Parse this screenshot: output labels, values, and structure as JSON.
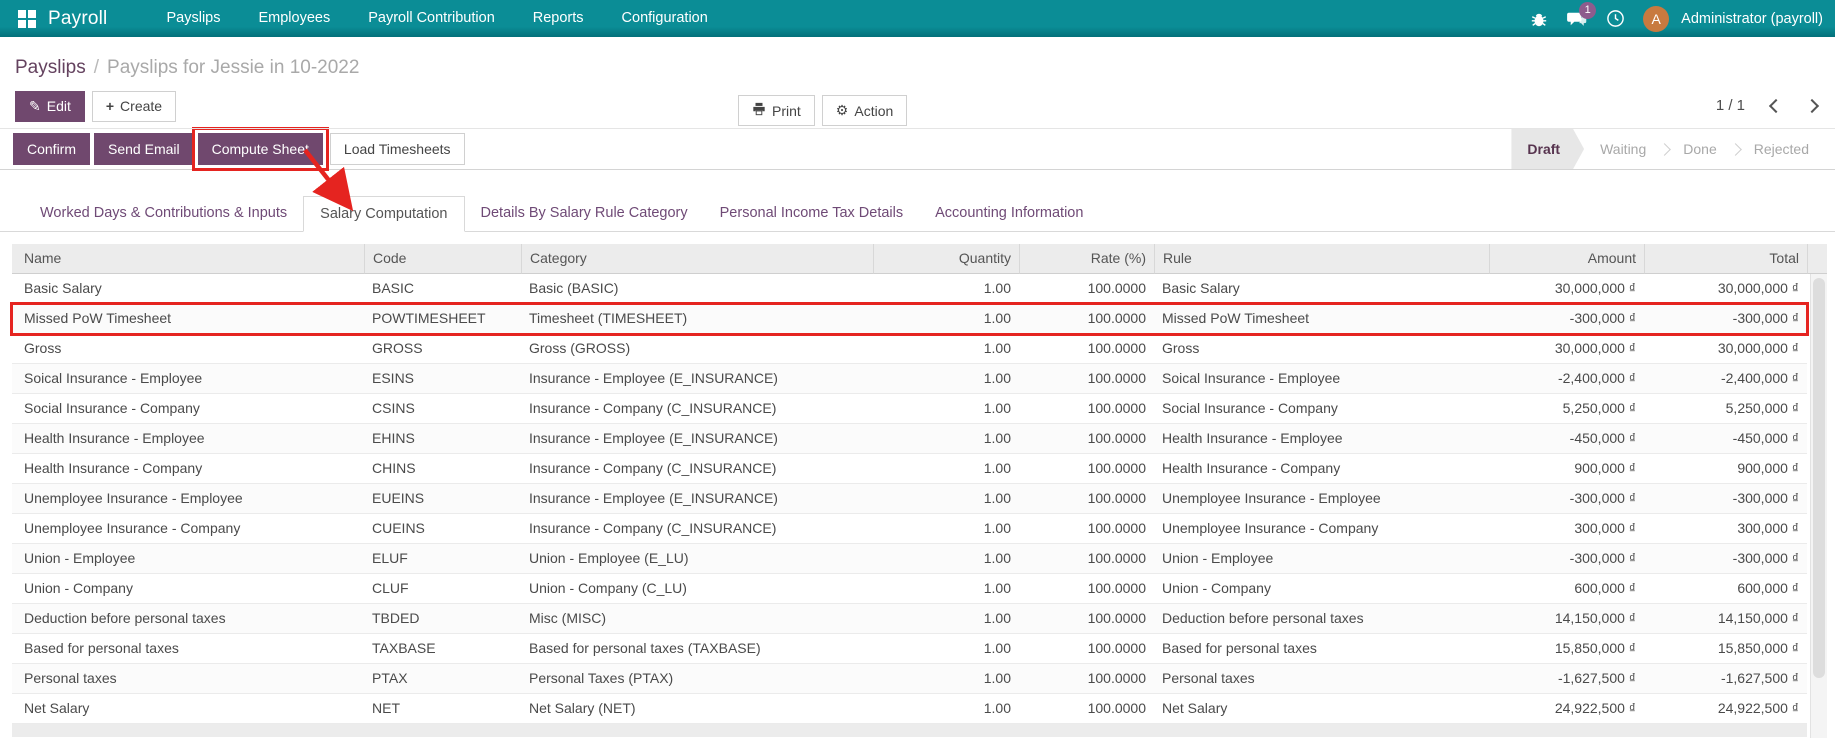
{
  "app": {
    "brand": "Payroll",
    "menus": [
      "Payslips",
      "Employees",
      "Payroll Contribution",
      "Reports",
      "Configuration"
    ],
    "user_name": "Administrator (payroll)",
    "avatar_letter": "A",
    "message_badge": "1"
  },
  "breadcrumb": {
    "parent": "Payslips",
    "separator": "/",
    "current": "Payslips for Jessie in 10-2022"
  },
  "actions": {
    "edit": "Edit",
    "create": "Create",
    "print": "Print",
    "action": "Action",
    "edit_icon_glyph": "✎",
    "create_icon_glyph": "+",
    "action_icon_glyph": "⚙"
  },
  "pager": {
    "value": "1 / 1"
  },
  "statusbar": {
    "buttons": [
      {
        "label": "Confirm",
        "style": "primary"
      },
      {
        "label": "Send Email",
        "style": "primary"
      },
      {
        "label": "Compute Sheet",
        "style": "primary"
      },
      {
        "label": "Load Timesheets",
        "style": "default"
      }
    ],
    "states": [
      "Draft",
      "Waiting",
      "Done",
      "Rejected"
    ],
    "active_state": "Draft"
  },
  "notebook": {
    "tabs": [
      "Worked Days & Contributions & Inputs",
      "Salary Computation",
      "Details By Salary Rule Category",
      "Personal Income Tax Details",
      "Accounting Information"
    ],
    "active_tab": "Salary Computation"
  },
  "table": {
    "columns": [
      {
        "key": "name",
        "label": "Name",
        "align": "left"
      },
      {
        "key": "code",
        "label": "Code",
        "align": "left"
      },
      {
        "key": "category",
        "label": "Category",
        "align": "left"
      },
      {
        "key": "quantity",
        "label": "Quantity",
        "align": "right"
      },
      {
        "key": "rate",
        "label": "Rate (%)",
        "align": "right"
      },
      {
        "key": "rule",
        "label": "Rule",
        "align": "left"
      },
      {
        "key": "amount",
        "label": "Amount",
        "align": "right"
      },
      {
        "key": "total",
        "label": "Total",
        "align": "right"
      }
    ],
    "rows": [
      {
        "name": "Basic Salary",
        "code": "BASIC",
        "category": "Basic (BASIC)",
        "quantity": "1.00",
        "rate": "100.0000",
        "rule": "Basic Salary",
        "amount": "30,000,000 ₫",
        "total": "30,000,000 ₫"
      },
      {
        "name": "Missed PoW Timesheet",
        "code": "POWTIMESHEET",
        "category": "Timesheet (TIMESHEET)",
        "quantity": "1.00",
        "rate": "100.0000",
        "rule": "Missed PoW Timesheet",
        "amount": "-300,000 ₫",
        "total": "-300,000 ₫"
      },
      {
        "name": "Gross",
        "code": "GROSS",
        "category": "Gross (GROSS)",
        "quantity": "1.00",
        "rate": "100.0000",
        "rule": "Gross",
        "amount": "30,000,000 ₫",
        "total": "30,000,000 ₫"
      },
      {
        "name": "Soical Insurance - Employee",
        "code": "ESINS",
        "category": "Insurance - Employee (E_INSURANCE)",
        "quantity": "1.00",
        "rate": "100.0000",
        "rule": "Soical Insurance - Employee",
        "amount": "-2,400,000 ₫",
        "total": "-2,400,000 ₫"
      },
      {
        "name": "Social Insurance - Company",
        "code": "CSINS",
        "category": "Insurance - Company (C_INSURANCE)",
        "quantity": "1.00",
        "rate": "100.0000",
        "rule": "Social Insurance - Company",
        "amount": "5,250,000 ₫",
        "total": "5,250,000 ₫"
      },
      {
        "name": "Health Insurance - Employee",
        "code": "EHINS",
        "category": "Insurance - Employee (E_INSURANCE)",
        "quantity": "1.00",
        "rate": "100.0000",
        "rule": "Health Insurance - Employee",
        "amount": "-450,000 ₫",
        "total": "-450,000 ₫"
      },
      {
        "name": "Health Insurance - Company",
        "code": "CHINS",
        "category": "Insurance - Company (C_INSURANCE)",
        "quantity": "1.00",
        "rate": "100.0000",
        "rule": "Health Insurance - Company",
        "amount": "900,000 ₫",
        "total": "900,000 ₫"
      },
      {
        "name": "Unemployee Insurance - Employee",
        "code": "EUEINS",
        "category": "Insurance - Employee (E_INSURANCE)",
        "quantity": "1.00",
        "rate": "100.0000",
        "rule": "Unemployee Insurance - Employee",
        "amount": "-300,000 ₫",
        "total": "-300,000 ₫"
      },
      {
        "name": "Unemployee Insurance - Company",
        "code": "CUEINS",
        "category": "Insurance - Company (C_INSURANCE)",
        "quantity": "1.00",
        "rate": "100.0000",
        "rule": "Unemployee Insurance - Company",
        "amount": "300,000 ₫",
        "total": "300,000 ₫"
      },
      {
        "name": "Union - Employee",
        "code": "ELUF",
        "category": "Union - Employee (E_LU)",
        "quantity": "1.00",
        "rate": "100.0000",
        "rule": "Union - Employee",
        "amount": "-300,000 ₫",
        "total": "-300,000 ₫"
      },
      {
        "name": "Union - Company",
        "code": "CLUF",
        "category": "Union - Company (C_LU)",
        "quantity": "1.00",
        "rate": "100.0000",
        "rule": "Union - Company",
        "amount": "600,000 ₫",
        "total": "600,000 ₫"
      },
      {
        "name": "Deduction before personal taxes",
        "code": "TBDED",
        "category": "Misc (MISC)",
        "quantity": "1.00",
        "rate": "100.0000",
        "rule": "Deduction before personal taxes",
        "amount": "14,150,000 ₫",
        "total": "14,150,000 ₫"
      },
      {
        "name": "Based for personal taxes",
        "code": "TAXBASE",
        "category": "Based for personal taxes (TAXBASE)",
        "quantity": "1.00",
        "rate": "100.0000",
        "rule": "Based for personal taxes",
        "amount": "15,850,000 ₫",
        "total": "15,850,000 ₫"
      },
      {
        "name": "Personal taxes",
        "code": "PTAX",
        "category": "Personal Taxes (PTAX)",
        "quantity": "1.00",
        "rate": "100.0000",
        "rule": "Personal taxes",
        "amount": "-1,627,500 ₫",
        "total": "-1,627,500 ₫"
      },
      {
        "name": "Net Salary",
        "code": "NET",
        "category": "Net Salary (NET)",
        "quantity": "1.00",
        "rate": "100.0000",
        "rule": "Net Salary",
        "amount": "24,922,500 ₫",
        "total": "24,922,500 ₫"
      }
    ]
  },
  "annotations": {
    "highlight_button": "Compute Sheet",
    "highlight_row": "Missed PoW Timesheet",
    "arrow_from": "compute-sheet-button",
    "arrow_to": "salary-computation-tab"
  },
  "colors": {
    "navbar_bg": "#0b8d96",
    "navbar_bg_dark": "#03707a",
    "accent_purple": "#70486e",
    "annotation_red": "#e52420",
    "avatar_orange": "#c87a3f",
    "badge_purple": "#8d5c8d"
  }
}
